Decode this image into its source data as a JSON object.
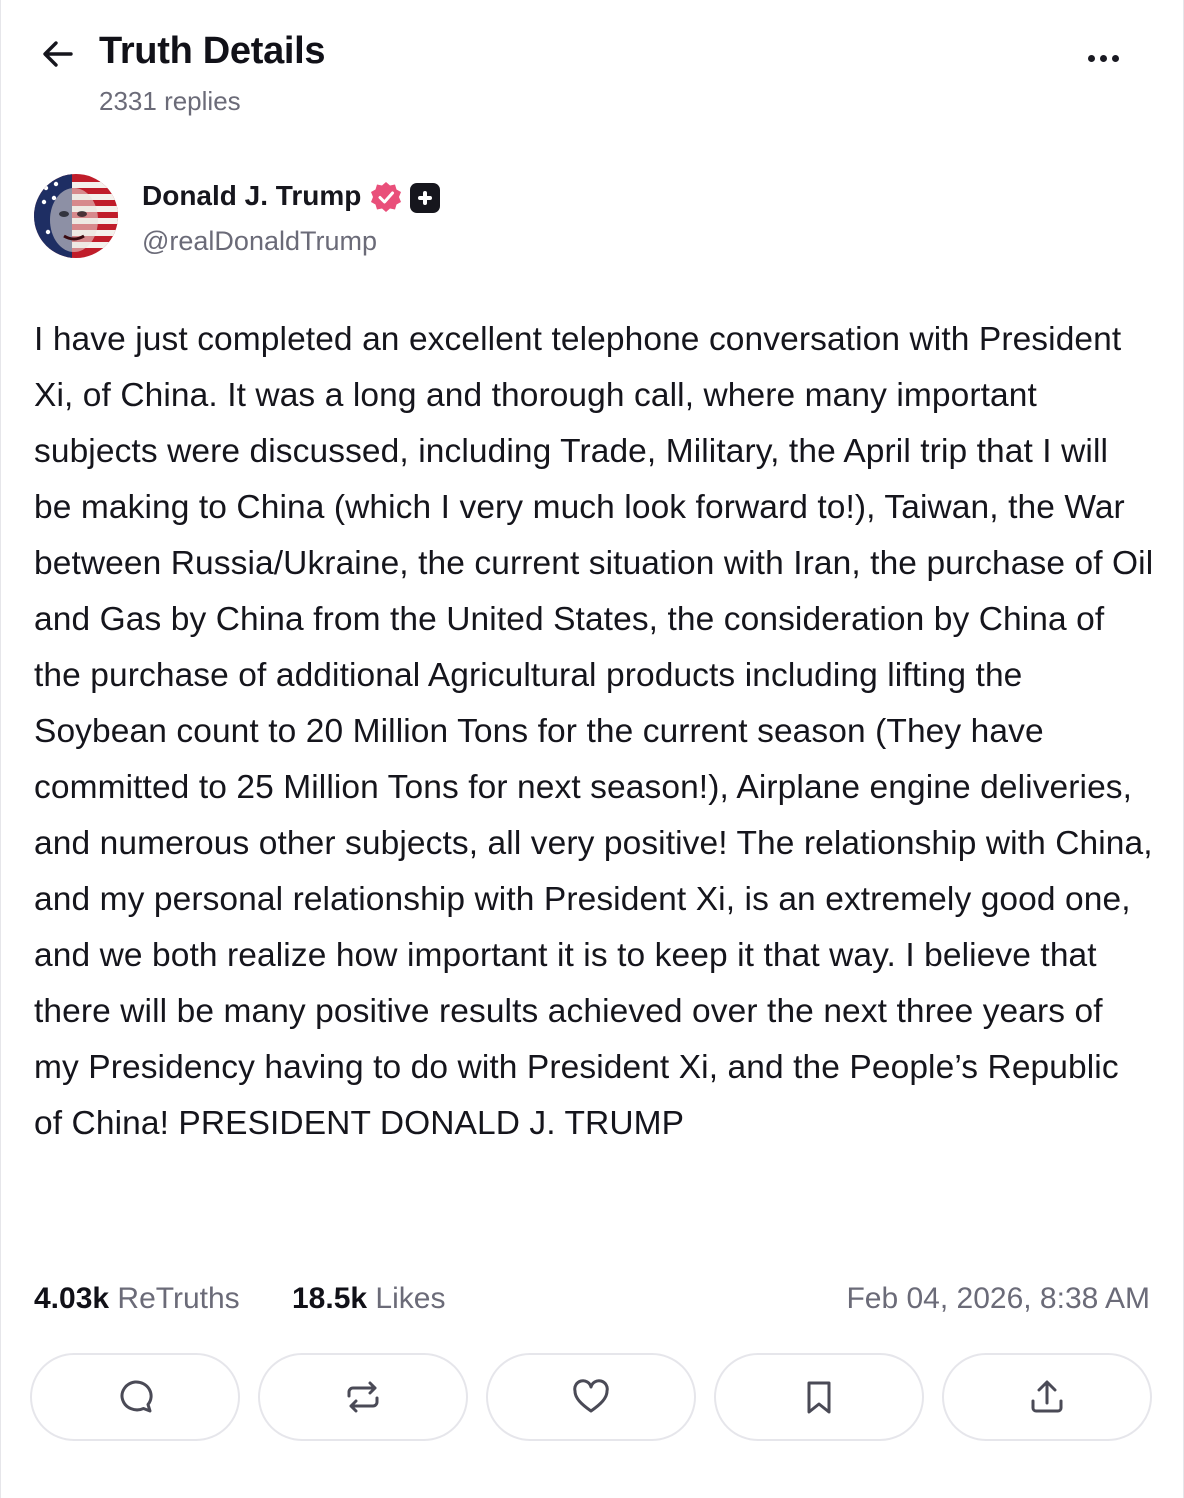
{
  "header": {
    "back_icon": "arrow-left-icon",
    "title": "Truth Details",
    "replies": "2331 replies",
    "more_icon": "ellipsis-horizontal-icon"
  },
  "author": {
    "name": "Donald J. Trump",
    "handle": "@realDonaldTrump",
    "verified_badge_color": "#e94f7a",
    "avatar_icon": "avatar-american-flag-portrait"
  },
  "post": {
    "text": "I have just completed an excellent telephone conversation with President Xi, of China. It was a long and thorough call, where many important subjects were discussed, including Trade, Military, the April trip that I will be making to China (which I very much look forward to!), Taiwan, the War between Russia/Ukraine, the current situation with Iran, the purchase of Oil and Gas by China from the United States, the consideration by China of the purchase of additional Agricultural products including lifting the Soybean count to 20 Million Tons for the current season (They have committed to 25 Million Tons for next season!), Airplane engine deliveries, and numerous other subjects, all very positive! The relationship with China, and my personal relationship with President Xi, is an extremely good one, and we both realize how important it is to keep it that way. I believe that there will be many positive results achieved over the next three years of my Presidency having to do with President Xi, and the People’s Republic of China! PRESIDENT DONALD J. TRUMP"
  },
  "stats": {
    "retruths_count": "4.03k",
    "retruths_label": "ReTruths",
    "likes_count": "18.5k",
    "likes_label": "Likes",
    "timestamp": "Feb 04, 2026, 8:38 AM"
  },
  "actions": [
    {
      "icon": "reply-icon"
    },
    {
      "icon": "retruth-icon"
    },
    {
      "icon": "heart-icon"
    },
    {
      "icon": "bookmark-icon"
    },
    {
      "icon": "share-icon"
    }
  ]
}
